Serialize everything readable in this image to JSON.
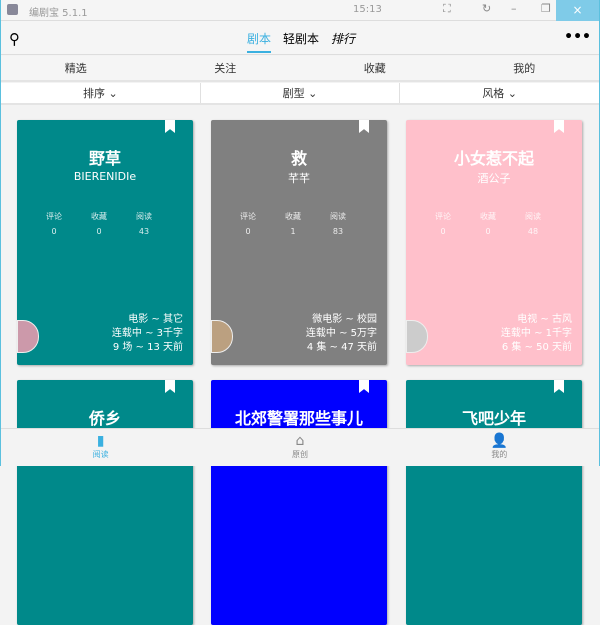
{
  "titlebar": {
    "app": "编剧宝  5.1.1",
    "time": "15:13",
    "close": "×"
  },
  "header": {
    "nav": [
      "剧本",
      "轻剧本",
      "排行"
    ]
  },
  "tabs": [
    "精选",
    "关注",
    "收藏",
    "我的"
  ],
  "filters": [
    "排序 ⌄",
    "剧型 ⌄",
    "风格 ⌄"
  ],
  "stat_labels": [
    "评论",
    "收藏",
    "阅读"
  ],
  "cards": [
    {
      "title": "野草",
      "author": "BIERENIDIe",
      "stats": [
        "0",
        "0",
        "43"
      ],
      "lines": [
        "电影 ~ 其它",
        "连载中 ~ 3千字",
        "9 场 ~ 13 天前"
      ],
      "color": "#00898a"
    },
    {
      "title": "救",
      "author": "芊芊",
      "stats": [
        "0",
        "1",
        "83"
      ],
      "lines": [
        "微电影 ~ 校园",
        "连载中 ~ 5万字",
        "4 集 ~ 47 天前"
      ],
      "color": "#808080"
    },
    {
      "title": "小女惹不起",
      "author": "酒公子",
      "stats": [
        "0",
        "0",
        "48"
      ],
      "lines": [
        "电视 ~ 古风",
        "连载中 ~ 1千字",
        "6 集 ~ 50 天前"
      ],
      "color": "#ffc0cb"
    },
    {
      "title": "侨乡",
      "color": "#00898a"
    },
    {
      "title": "北郊警署那些事儿",
      "color": "#0000ff"
    },
    {
      "title": "飞吧少年",
      "color": "#00898a"
    }
  ],
  "bottom_nav": [
    "阅读",
    "原创",
    "我的"
  ]
}
